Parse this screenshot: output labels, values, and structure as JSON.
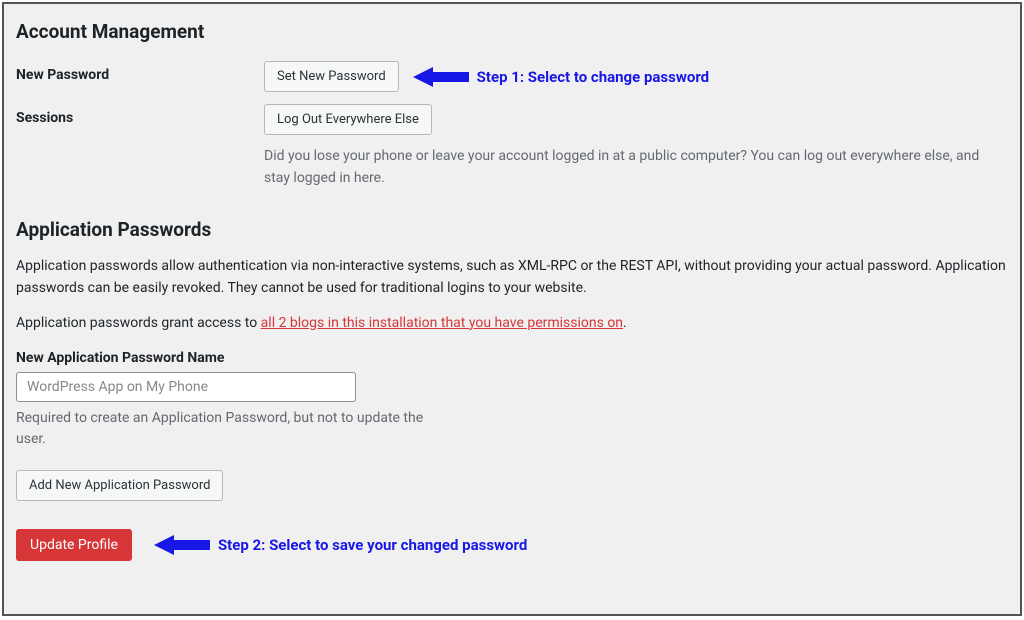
{
  "section1_title": "Account Management",
  "new_password": {
    "label": "New Password",
    "button": "Set New Password"
  },
  "sessions": {
    "label": "Sessions",
    "button": "Log Out Everywhere Else",
    "description": "Did you lose your phone or leave your account logged in at a public computer? You can log out everywhere else, and stay logged in here."
  },
  "section2_title": "Application Passwords",
  "app_pw": {
    "intro": "Application passwords allow authentication via non-interactive systems, such as XML-RPC or the REST API, without providing your actual password. Application passwords can be easily revoked. They cannot be used for traditional logins to your website.",
    "grant_prefix": "Application passwords grant access to ",
    "grant_link": "all 2 blogs in this installation that you have permissions on",
    "grant_suffix": ".",
    "name_label": "New Application Password Name",
    "name_placeholder": "WordPress App on My Phone",
    "name_hint": "Required to create an Application Password, but not to update the user.",
    "add_button": "Add New Application Password"
  },
  "update_button": "Update Profile",
  "annotations": {
    "step1": "Step 1: Select to change password",
    "step2": "Step 2: Select to save your changed password"
  },
  "colors": {
    "annotation": "#1818e6",
    "primary": "#d63638",
    "link": "#d63638"
  }
}
